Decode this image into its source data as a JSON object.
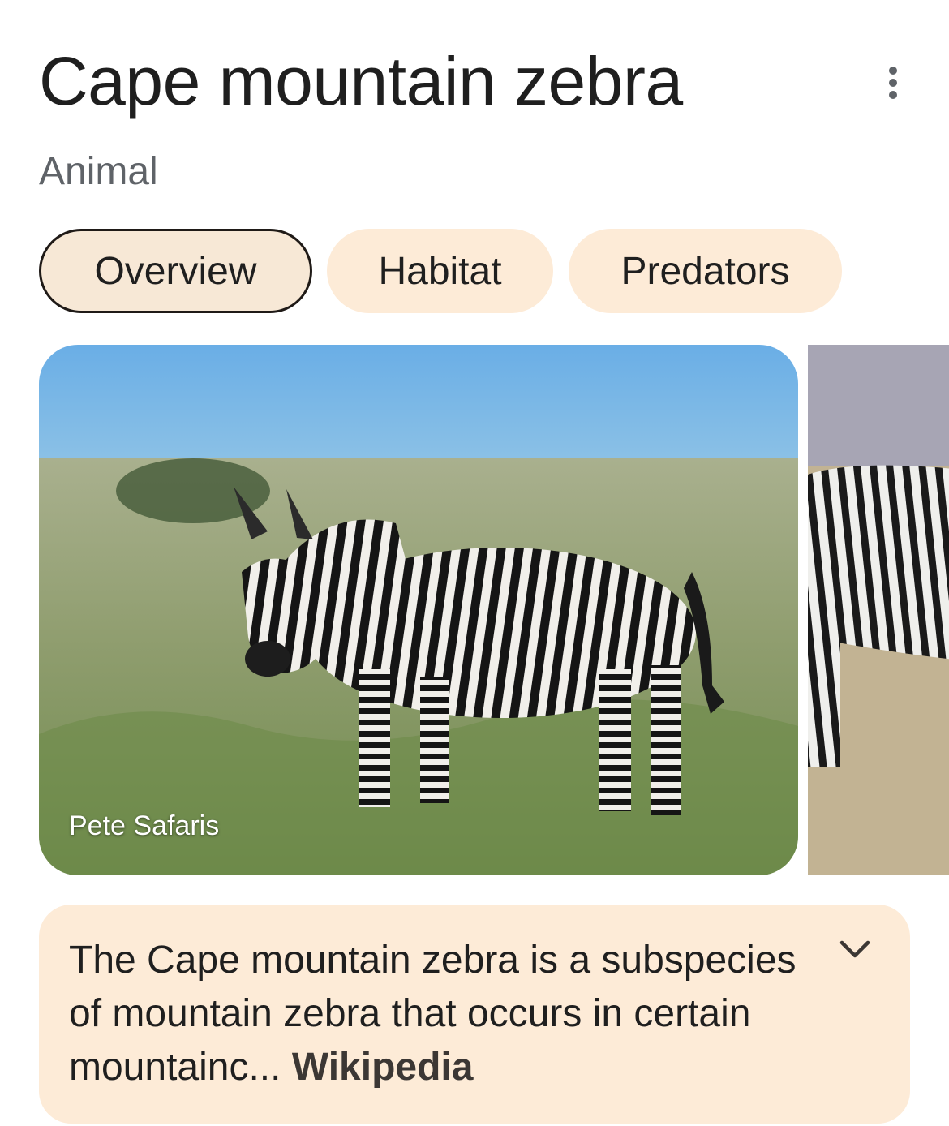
{
  "header": {
    "title": "Cape mountain zebra",
    "subtitle": "Animal",
    "more_icon": "more-vertical-icon"
  },
  "tabs": [
    {
      "label": "Overview",
      "active": true
    },
    {
      "label": "Habitat",
      "active": false
    },
    {
      "label": "Predators",
      "active": false
    }
  ],
  "images": {
    "main_credit": "Pete Safaris"
  },
  "description": {
    "text": "The Cape mountain zebra is a subspecies of mountain zebra that occurs in certain mountainc...",
    "source": "Wikipedia",
    "expand_icon": "chevron-down-icon"
  },
  "colors": {
    "chip_bg": "#fdebd7",
    "active_chip_border": "#1f1a17",
    "title": "#1f1f1f",
    "subtitle": "#5f6368"
  }
}
